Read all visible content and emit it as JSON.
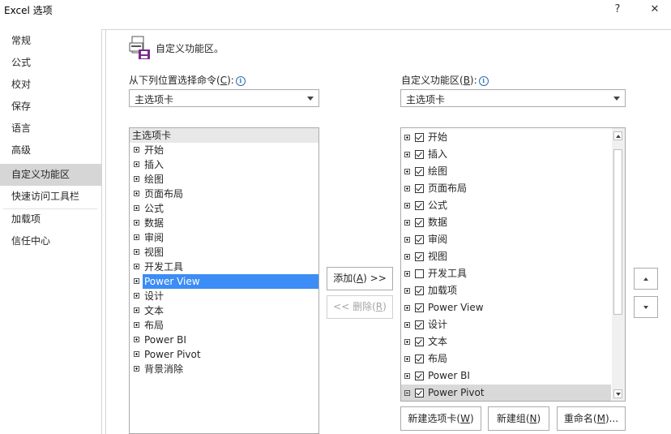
{
  "window": {
    "title": "Excel 选项",
    "help": "?",
    "close": "✕"
  },
  "sidebar": {
    "items": [
      {
        "label": "常规"
      },
      {
        "label": "公式"
      },
      {
        "label": "校对"
      },
      {
        "label": "保存"
      },
      {
        "label": "语言"
      },
      {
        "label": "高级"
      },
      {
        "label": "自定义功能区",
        "active": true
      },
      {
        "label": "快速访问工具栏"
      },
      {
        "label": "加载项"
      },
      {
        "label": "信任中心"
      }
    ]
  },
  "header": {
    "title": "自定义功能区。"
  },
  "left": {
    "label": "从下列位置选择命令(",
    "label_key": "C",
    "label_end": "):",
    "dropdown_value": "主选项卡",
    "list_header": "主选项卡",
    "items": [
      "开始",
      "插入",
      "绘图",
      "页面布局",
      "公式",
      "数据",
      "审阅",
      "视图",
      "开发工具",
      "Power View",
      "设计",
      "文本",
      "布局",
      "Power BI",
      "Power Pivot",
      "背景消除"
    ],
    "selected": "Power View"
  },
  "middle": {
    "add_label": "添加(",
    "add_key": "A",
    "add_end": ") >>",
    "remove_label": "<< 删除(",
    "remove_key": "R",
    "remove_end": ")"
  },
  "right": {
    "label": "自定义功能区(",
    "label_key": "B",
    "label_end": "):",
    "dropdown_value": "主选项卡",
    "items": [
      {
        "label": "开始",
        "checked": true,
        "expanded": false
      },
      {
        "label": "插入",
        "checked": true,
        "expanded": false
      },
      {
        "label": "绘图",
        "checked": true,
        "expanded": false
      },
      {
        "label": "页面布局",
        "checked": true,
        "expanded": false
      },
      {
        "label": "公式",
        "checked": true,
        "expanded": false
      },
      {
        "label": "数据",
        "checked": true,
        "expanded": false
      },
      {
        "label": "审阅",
        "checked": true,
        "expanded": false
      },
      {
        "label": "视图",
        "checked": true,
        "expanded": false
      },
      {
        "label": "开发工具",
        "checked": false,
        "expanded": false
      },
      {
        "label": "加载项",
        "checked": true,
        "expanded": false
      },
      {
        "label": "Power View",
        "checked": true,
        "expanded": false
      },
      {
        "label": "设计",
        "checked": true,
        "expanded": false
      },
      {
        "label": "文本",
        "checked": true,
        "expanded": false
      },
      {
        "label": "布局",
        "checked": true,
        "expanded": false
      },
      {
        "label": "Power BI",
        "checked": true,
        "expanded": false
      },
      {
        "label": "Power Pivot",
        "checked": true,
        "expanded": true,
        "highlighted": true
      }
    ],
    "new_tab": "新建选项卡(",
    "new_tab_key": "W",
    "new_tab_end": ")",
    "new_group": "新建组(",
    "new_group_key": "N",
    "new_group_end": ")",
    "rename": "重命名(",
    "rename_key": "M",
    "rename_end": ")..."
  },
  "colors": {
    "selection": "#3c8df5",
    "sidebar_active": "#d6d6d6",
    "highlight_row": "#d9d9d9"
  }
}
